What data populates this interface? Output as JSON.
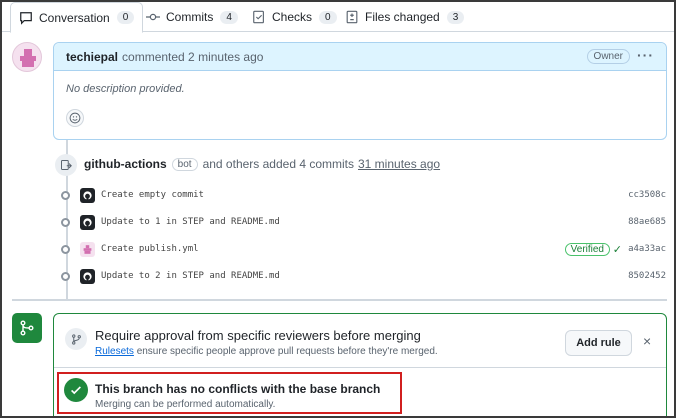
{
  "tabs": [
    {
      "label": "Conversation",
      "count": "0",
      "icon": "comment-icon"
    },
    {
      "label": "Commits",
      "count": "4",
      "icon": "commit-icon"
    },
    {
      "label": "Checks",
      "count": "0",
      "icon": "checklist-icon"
    },
    {
      "label": "Files changed",
      "count": "3",
      "icon": "file-diff-icon"
    }
  ],
  "comment": {
    "author": "techiepal",
    "meta": "commented 2 minutes ago",
    "role_badge": "Owner",
    "body": "No description provided."
  },
  "commit_group": {
    "author": "github-actions",
    "badge": "bot",
    "text": "and others added 4 commits",
    "time": "31 minutes ago"
  },
  "commits": [
    {
      "message": "Create empty commit",
      "sha": "cc3508c",
      "avatar": "github-icon"
    },
    {
      "message": "Update to 1 in STEP and README.md",
      "sha": "88ae685",
      "avatar": "github-icon"
    },
    {
      "message": "Create publish.yml",
      "sha": "a4a33ac",
      "avatar": "user-avatar",
      "verified": "Verified"
    },
    {
      "message": "Update to 2 in STEP and README.md",
      "sha": "8502452",
      "avatar": "github-icon"
    }
  ],
  "merge": {
    "rule_title": "Require approval from specific reviewers before merging",
    "rule_link": "Rulesets",
    "rule_text": "ensure specific people approve pull requests before they're merged.",
    "add_rule_label": "Add rule",
    "close_label": "×",
    "conflict_title": "This branch has no conflicts with the base branch",
    "conflict_sub": "Merging can be performed automatically."
  },
  "colors": {
    "accent_green": "#1f883d",
    "link_blue": "#0969da",
    "highlight_red": "#d11f1f",
    "comment_header_bg": "#ddf4ff"
  }
}
